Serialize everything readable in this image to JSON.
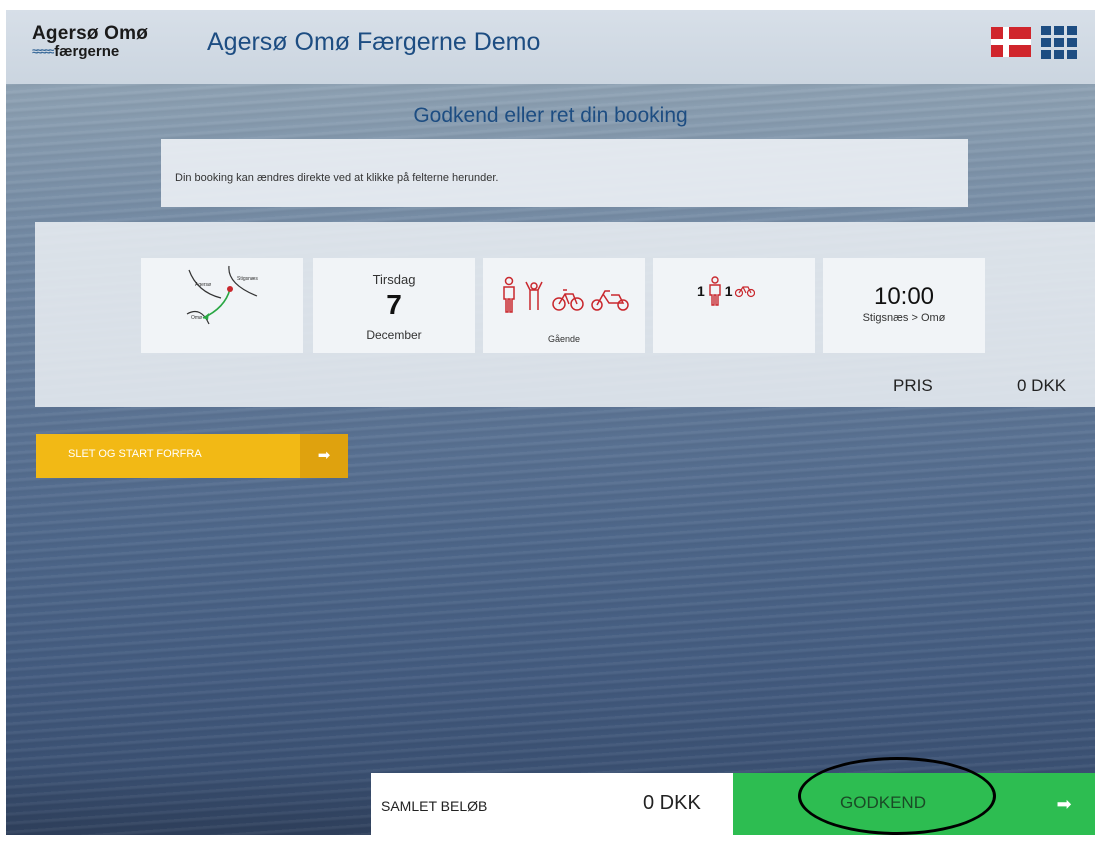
{
  "header": {
    "logo_top": "Agersø Omø",
    "logo_bottom": "færgerne",
    "title": "Agersø Omø Færgerne Demo",
    "icons": [
      "danish-flag-icon",
      "app-grid-icon"
    ]
  },
  "main": {
    "heading": "Godkend eller ret din booking",
    "info_text": "Din booking kan ændres direkte ved at klikke på felterne herunder."
  },
  "booking": {
    "route": {
      "from_label": "Agersø",
      "to_label": "Stigsnæs",
      "other_label": "Omø"
    },
    "date": {
      "weekday": "Tirsdag",
      "day": "7",
      "month": "December"
    },
    "travel_type": {
      "label": "Gående",
      "icons": [
        "walking-person-icon",
        "child-icon",
        "bicycle-icon",
        "moped-icon"
      ]
    },
    "passengers": {
      "adults": "1",
      "bikes": "1"
    },
    "departure": {
      "time": "10:00",
      "route": "Stigsnæs > Omø"
    },
    "price": {
      "label": "PRIS",
      "value": "0 DKK"
    }
  },
  "actions": {
    "reset_label": "SLET OG START FORFRA",
    "reset_arrow": "➡",
    "total_label": "SAMLET BELØB",
    "total_value": "0 DKK",
    "approve_label": "GODKEND",
    "approve_arrow": "➡"
  },
  "colors": {
    "brand_blue": "#1d4d82",
    "accent_red": "#c9282e",
    "reset_yellow": "#f2b915",
    "approve_green": "#2dbd51"
  }
}
